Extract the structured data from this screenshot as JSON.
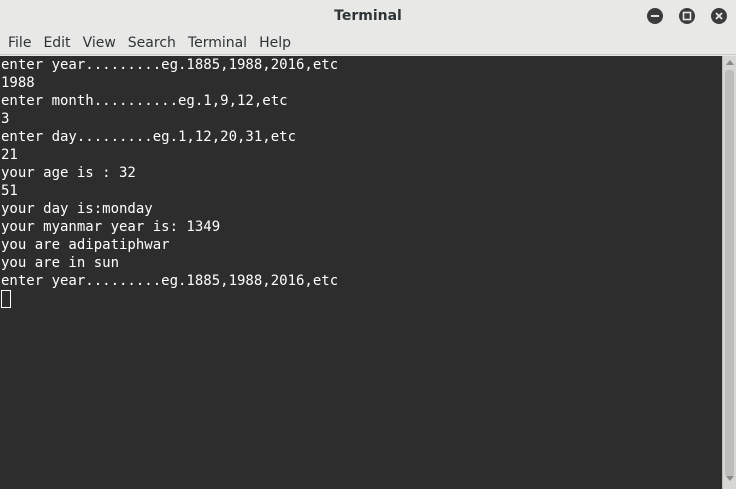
{
  "window": {
    "title": "Terminal"
  },
  "menu": {
    "items": [
      "File",
      "Edit",
      "View",
      "Search",
      "Terminal",
      "Help"
    ]
  },
  "terminal": {
    "lines": [
      "enter year.........eg.1885,1988,2016,etc",
      "1988",
      "enter month..........eg.1,9,12,etc",
      "3",
      "enter day.........eg.1,12,20,31,etc",
      "21",
      "your age is : 32",
      "51",
      "your day is:monday",
      "your myanmar year is: 1349",
      "you are adipatiphwar",
      "you are in sun",
      "enter year.........eg.1885,1988,2016,etc"
    ]
  },
  "colors": {
    "terminal_bg": "#2d2d2d",
    "terminal_fg": "#ffffff",
    "chrome_bg": "#e8e8e7"
  }
}
